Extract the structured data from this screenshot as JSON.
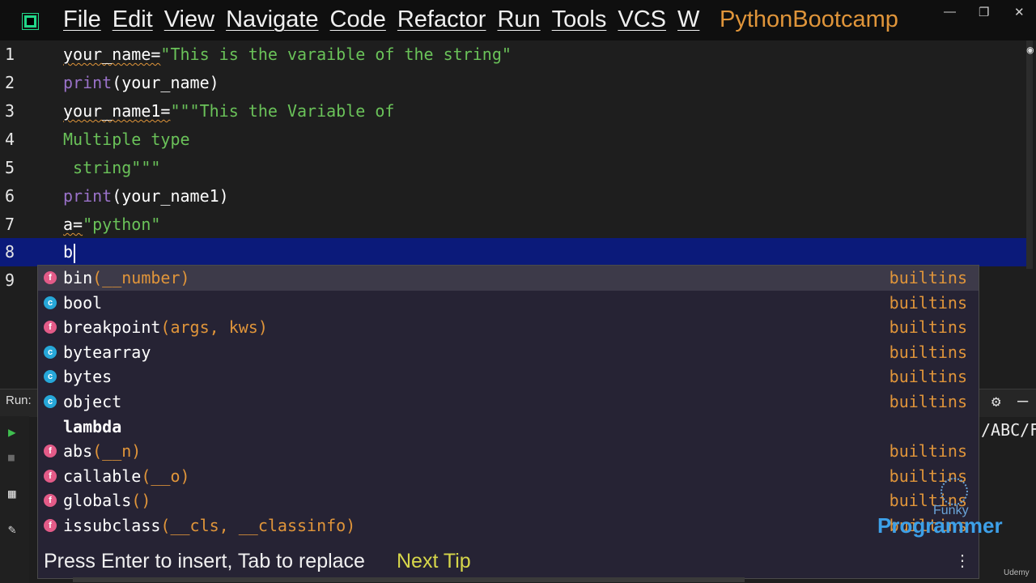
{
  "menu": {
    "items": [
      "File",
      "Edit",
      "View",
      "Navigate",
      "Code",
      "Refactor",
      "Run",
      "Tools",
      "VCS",
      "W"
    ],
    "project": "PythonBootcamp"
  },
  "editor": {
    "lines": [
      {
        "num": "1",
        "a": "your_name=",
        "b": "\"This is the varaible of the string\""
      },
      {
        "num": "2",
        "a": "print",
        "b": "(your_name)"
      },
      {
        "num": "3",
        "a": "your_name1=",
        "b": "\"\"\"This the Variable of"
      },
      {
        "num": "4",
        "a": "",
        "b": "Multiple type"
      },
      {
        "num": "5",
        "a": "",
        "b": " string\"\"\""
      },
      {
        "num": "6",
        "a": "print",
        "b": "(your_name1)"
      },
      {
        "num": "7",
        "a": "a=",
        "b": "\"python\""
      },
      {
        "num": "8",
        "a": "b",
        "b": ""
      },
      {
        "num": "9",
        "a": "",
        "b": ""
      }
    ]
  },
  "run": {
    "label": "Run:",
    "output_fragment": "/ABC/F"
  },
  "completion": {
    "items": [
      {
        "kind": "f",
        "name": "bin",
        "sig": "(__number)",
        "src": "builtins"
      },
      {
        "kind": "c",
        "name": "bool",
        "sig": "",
        "src": "builtins"
      },
      {
        "kind": "f",
        "name": "breakpoint",
        "sig": "(args, kws)",
        "src": "builtins"
      },
      {
        "kind": "c",
        "name": "bytearray",
        "sig": "",
        "src": "builtins"
      },
      {
        "kind": "c",
        "name": "bytes",
        "sig": "",
        "src": "builtins"
      },
      {
        "kind": "c",
        "name": "object",
        "sig": "",
        "src": "builtins"
      },
      {
        "kind": "",
        "name": "lambda",
        "sig": "",
        "src": ""
      },
      {
        "kind": "f",
        "name": "abs",
        "sig": "(__n)",
        "src": "builtins"
      },
      {
        "kind": "f",
        "name": "callable",
        "sig": "(__o)",
        "src": "builtins"
      },
      {
        "kind": "f",
        "name": "globals",
        "sig": "()",
        "src": "builtins"
      },
      {
        "kind": "f",
        "name": "issubclass",
        "sig": "(__cls, __classinfo)",
        "src": "builtins"
      }
    ],
    "footer": "Press Enter to insert, Tab to replace",
    "next_tip": "Next Tip"
  },
  "watermark": {
    "line1": "Funky",
    "line2": "Programmer",
    "platform": "Udemy"
  },
  "icons": {
    "close": "✕",
    "restore": "❐",
    "minimize": "—",
    "gear": "⚙",
    "more": "⋮",
    "play": "▶",
    "stop": "■"
  }
}
